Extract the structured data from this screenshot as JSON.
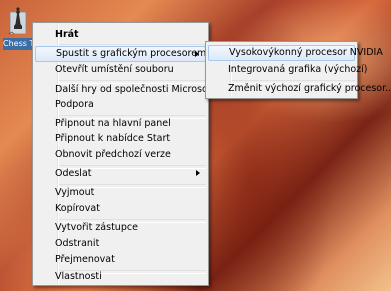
{
  "desktop": {
    "icon_label": "Chess T"
  },
  "context_menu": {
    "items": [
      {
        "label": "Hrát",
        "bold": true
      },
      {
        "label": "Spustit s grafickým procesorem",
        "submenu": true,
        "highlighted": true
      },
      {
        "label": "Otevřít umístění souboru"
      },
      {
        "label": "Další hry od společnosti Microsoft"
      },
      {
        "label": "Podpora"
      },
      {
        "label": "Připnout na hlavní panel"
      },
      {
        "label": "Připnout k nabídce Start"
      },
      {
        "label": "Obnovit předchozí verze"
      },
      {
        "label": "Odeslat",
        "submenu": true
      },
      {
        "label": "Vyjmout"
      },
      {
        "label": "Kopírovat"
      },
      {
        "label": "Vytvořit zástupce"
      },
      {
        "label": "Odstranit"
      },
      {
        "label": "Přejmenovat"
      },
      {
        "label": "Vlastnosti"
      }
    ]
  },
  "gpu_submenu": {
    "items": [
      {
        "label": "Vysokovýkonný procesor NVIDIA",
        "highlighted": true
      },
      {
        "label": "Integrovaná grafika (výchozí)"
      },
      {
        "label": "Změnit výchozí grafický procesor..."
      }
    ]
  },
  "colors": {
    "menu_background": "#f0f0f0",
    "highlight": "#dde9f8",
    "highlight_border": "#a8c8ee"
  }
}
